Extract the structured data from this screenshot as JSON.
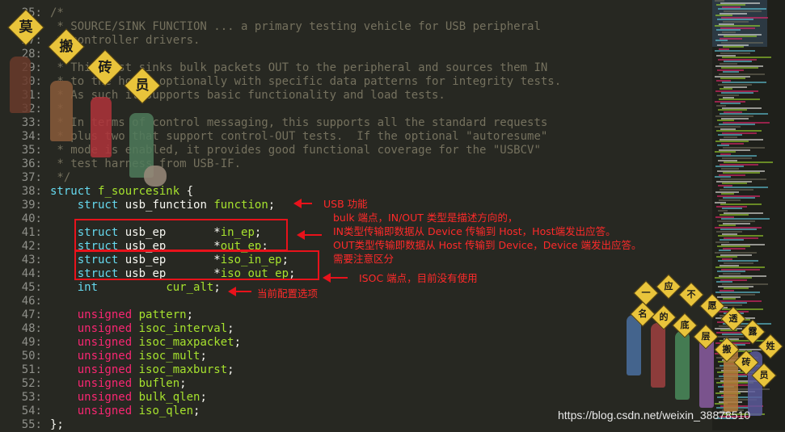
{
  "code_lines": [
    {
      "n": "25:",
      "parts": [
        {
          "c": "c",
          "s": "/*"
        }
      ]
    },
    {
      "n": "26:",
      "parts": [
        {
          "c": "c",
          "s": " * SOURCE/SINK FUNCTION ... a primary testing vehicle for USB peripheral"
        }
      ]
    },
    {
      "n": "27:",
      "parts": [
        {
          "c": "c",
          "s": " * controller drivers."
        }
      ]
    },
    {
      "n": "28:",
      "parts": [
        {
          "c": "c",
          "s": " *"
        }
      ]
    },
    {
      "n": "29:",
      "parts": [
        {
          "c": "c",
          "s": " * This just sinks bulk packets OUT to the peripheral and sources them IN"
        }
      ]
    },
    {
      "n": "30:",
      "parts": [
        {
          "c": "c",
          "s": " * to the host, optionally with specific data patterns for integrity tests."
        }
      ]
    },
    {
      "n": "31:",
      "parts": [
        {
          "c": "c",
          "s": " * As such it supports basic functionality and load tests."
        }
      ]
    },
    {
      "n": "32:",
      "parts": [
        {
          "c": "c",
          "s": " *"
        }
      ]
    },
    {
      "n": "33:",
      "parts": [
        {
          "c": "c",
          "s": " * In terms of control messaging, this supports all the standard requests"
        }
      ]
    },
    {
      "n": "34:",
      "parts": [
        {
          "c": "c",
          "s": " * plus two that support control-OUT tests.  If the optional \"autoresume\""
        }
      ]
    },
    {
      "n": "35:",
      "parts": [
        {
          "c": "c",
          "s": " * mode is enabled, it provides good functional coverage for the \"USBCV\""
        }
      ]
    },
    {
      "n": "36:",
      "parts": [
        {
          "c": "c",
          "s": " * test harness from USB-IF."
        }
      ]
    },
    {
      "n": "37:",
      "parts": [
        {
          "c": "c",
          "s": " */"
        }
      ]
    },
    {
      "n": "38:",
      "parts": [
        {
          "c": "k",
          "s": "struct"
        },
        {
          "c": "t",
          "s": " "
        },
        {
          "c": "f",
          "s": "f_sourcesink"
        },
        {
          "c": "p",
          "s": " {"
        }
      ]
    },
    {
      "n": "39:",
      "parts": [
        {
          "c": "t",
          "s": "    "
        },
        {
          "c": "k",
          "s": "struct"
        },
        {
          "c": "t",
          "s": " usb_function "
        },
        {
          "c": "f",
          "s": "function"
        },
        {
          "c": "p",
          "s": ";"
        }
      ]
    },
    {
      "n": "40:",
      "parts": [
        {
          "c": "t",
          "s": ""
        }
      ]
    },
    {
      "n": "41:",
      "parts": [
        {
          "c": "t",
          "s": "    "
        },
        {
          "c": "k",
          "s": "struct"
        },
        {
          "c": "t",
          "s": " usb_ep       *"
        },
        {
          "c": "f",
          "s": "in_ep"
        },
        {
          "c": "p",
          "s": ";"
        }
      ]
    },
    {
      "n": "42:",
      "parts": [
        {
          "c": "t",
          "s": "    "
        },
        {
          "c": "k",
          "s": "struct"
        },
        {
          "c": "t",
          "s": " usb_ep       *"
        },
        {
          "c": "f",
          "s": "out_ep"
        },
        {
          "c": "p",
          "s": ";"
        }
      ]
    },
    {
      "n": "43:",
      "parts": [
        {
          "c": "t",
          "s": "    "
        },
        {
          "c": "k",
          "s": "struct"
        },
        {
          "c": "t",
          "s": " usb_ep       *"
        },
        {
          "c": "f",
          "s": "iso_in_ep"
        },
        {
          "c": "p",
          "s": ";"
        }
      ]
    },
    {
      "n": "44:",
      "parts": [
        {
          "c": "t",
          "s": "    "
        },
        {
          "c": "k",
          "s": "struct"
        },
        {
          "c": "t",
          "s": " usb_ep       *"
        },
        {
          "c": "f",
          "s": "iso_out_ep"
        },
        {
          "c": "p",
          "s": ";"
        }
      ]
    },
    {
      "n": "45:",
      "parts": [
        {
          "c": "t",
          "s": "    "
        },
        {
          "c": "k",
          "s": "int"
        },
        {
          "c": "t",
          "s": "          "
        },
        {
          "c": "f",
          "s": "cur_alt"
        },
        {
          "c": "p",
          "s": ";"
        }
      ]
    },
    {
      "n": "46:",
      "parts": [
        {
          "c": "t",
          "s": ""
        }
      ]
    },
    {
      "n": "47:",
      "parts": [
        {
          "c": "t",
          "s": "    "
        },
        {
          "c": "m",
          "s": "unsigned"
        },
        {
          "c": "t",
          "s": " "
        },
        {
          "c": "f",
          "s": "pattern"
        },
        {
          "c": "p",
          "s": ";"
        }
      ]
    },
    {
      "n": "48:",
      "parts": [
        {
          "c": "t",
          "s": "    "
        },
        {
          "c": "m",
          "s": "unsigned"
        },
        {
          "c": "t",
          "s": " "
        },
        {
          "c": "f",
          "s": "isoc_interval"
        },
        {
          "c": "p",
          "s": ";"
        }
      ]
    },
    {
      "n": "49:",
      "parts": [
        {
          "c": "t",
          "s": "    "
        },
        {
          "c": "m",
          "s": "unsigned"
        },
        {
          "c": "t",
          "s": " "
        },
        {
          "c": "f",
          "s": "isoc_maxpacket"
        },
        {
          "c": "p",
          "s": ";"
        }
      ]
    },
    {
      "n": "50:",
      "parts": [
        {
          "c": "t",
          "s": "    "
        },
        {
          "c": "m",
          "s": "unsigned"
        },
        {
          "c": "t",
          "s": " "
        },
        {
          "c": "f",
          "s": "isoc_mult"
        },
        {
          "c": "p",
          "s": ";"
        }
      ]
    },
    {
      "n": "51:",
      "parts": [
        {
          "c": "t",
          "s": "    "
        },
        {
          "c": "m",
          "s": "unsigned"
        },
        {
          "c": "t",
          "s": " "
        },
        {
          "c": "f",
          "s": "isoc_maxburst"
        },
        {
          "c": "p",
          "s": ";"
        }
      ]
    },
    {
      "n": "52:",
      "parts": [
        {
          "c": "t",
          "s": "    "
        },
        {
          "c": "m",
          "s": "unsigned"
        },
        {
          "c": "t",
          "s": " "
        },
        {
          "c": "f",
          "s": "buflen"
        },
        {
          "c": "p",
          "s": ";"
        }
      ]
    },
    {
      "n": "53:",
      "parts": [
        {
          "c": "t",
          "s": "    "
        },
        {
          "c": "m",
          "s": "unsigned"
        },
        {
          "c": "t",
          "s": " "
        },
        {
          "c": "f",
          "s": "bulk_qlen"
        },
        {
          "c": "p",
          "s": ";"
        }
      ]
    },
    {
      "n": "54:",
      "parts": [
        {
          "c": "t",
          "s": "    "
        },
        {
          "c": "m",
          "s": "unsigned"
        },
        {
          "c": "t",
          "s": " "
        },
        {
          "c": "f",
          "s": "iso_qlen"
        },
        {
          "c": "p",
          "s": ";"
        }
      ]
    },
    {
      "n": "55:",
      "parts": [
        {
          "c": "p",
          "s": "};"
        }
      ]
    }
  ],
  "annotations": {
    "usb_function": "USB 功能",
    "bulk_line1": "bulk 端点，IN/OUT 类型是描述方向的，",
    "bulk_line2": "IN类型传输即数据从 Device 传输到 Host，Host端发出应答。",
    "bulk_line3": "OUT类型传输即数据从 Host 传输到 Device，Device 端发出应答。",
    "bulk_line4": "需要注意区分",
    "isoc": "ISOC 端点，目前没有使用",
    "cur_alt": "当前配置选项"
  },
  "stickers": {
    "left_signs": [
      "莫",
      "搬",
      "砖",
      "员"
    ],
    "right_signs": [
      "一",
      "应",
      "不",
      "愿",
      "透",
      "露",
      "姓",
      "名",
      "的",
      "底",
      "层",
      "搬",
      "砖",
      "员"
    ]
  },
  "watermark": "https://blog.csdn.net/weixin_38878510",
  "colors": {
    "background": "#272822",
    "comment": "#75715e",
    "keyword": "#66d9ef",
    "identifier": "#a6e22e",
    "type_unsigned": "#f92672",
    "annotation_red": "#e8121b"
  }
}
